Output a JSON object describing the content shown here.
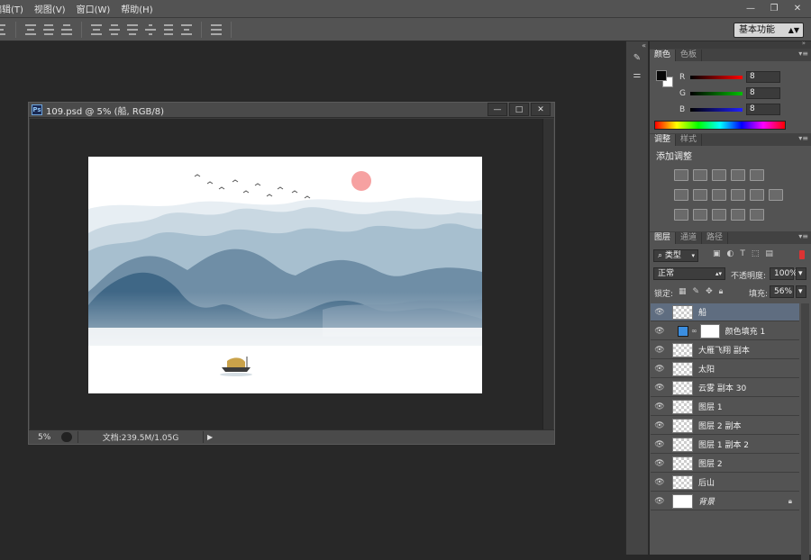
{
  "menubar": {
    "items": [
      "编辑(T)",
      "视图(V)",
      "窗口(W)",
      "帮助(H)"
    ]
  },
  "window_controls": {
    "minimize": "—",
    "restore": "❐",
    "close": "✕"
  },
  "workspace": {
    "label": "基本功能"
  },
  "document": {
    "ps_badge": "Ps",
    "title": "109.psd @ 5% (船, RGB/8)",
    "zoom": "5%",
    "doc_info": "文档:239.5M/1.05G"
  },
  "color_panel": {
    "tabs": [
      "颜色",
      "色板"
    ],
    "channels": [
      {
        "label": "R",
        "value": "8",
        "color": "#ff0000"
      },
      {
        "label": "G",
        "value": "8",
        "color": "#00c000"
      },
      {
        "label": "B",
        "value": "8",
        "color": "#2020ff"
      }
    ]
  },
  "adjust_panel": {
    "tabs": [
      "调整",
      "样式"
    ],
    "title": "添加调整"
  },
  "layers_panel": {
    "tabs": [
      "图层",
      "通道",
      "路径"
    ],
    "kind_filter": "类型",
    "blend_mode": "正常",
    "opacity_label": "不透明度:",
    "opacity": "100%",
    "lock_label": "锁定:",
    "fill_label": "填充:",
    "fill": "56%",
    "layers": [
      {
        "name": "船",
        "selected": true
      },
      {
        "name": "颜色填充 1",
        "fill": true
      },
      {
        "name": "大雁飞翔 副本"
      },
      {
        "name": "太阳"
      },
      {
        "name": "云雾 副本 30"
      },
      {
        "name": "图层 1"
      },
      {
        "name": "图层 2 副本"
      },
      {
        "name": "图层 1 副本 2"
      },
      {
        "name": "图层 2"
      },
      {
        "name": "后山"
      },
      {
        "name": "背景",
        "locked": true
      }
    ]
  },
  "colors": {
    "fill_swatch": "#3b8ee0",
    "selected_layer": "#5f6d80",
    "sun": "#f46f6f"
  }
}
